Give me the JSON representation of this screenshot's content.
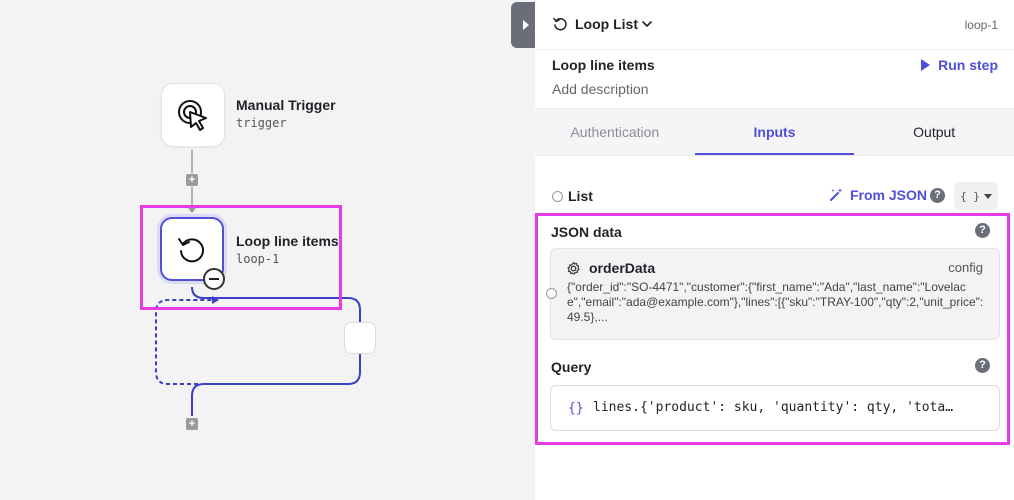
{
  "canvas": {
    "nodes": [
      {
        "title": "Manual Trigger",
        "subtitle": "trigger"
      },
      {
        "title": "Loop line items",
        "subtitle": "loop-1"
      }
    ]
  },
  "panel": {
    "header": {
      "title": "Loop List",
      "step_id": "loop-1"
    },
    "step_name": "Loop line items",
    "description_placeholder": "Add description",
    "run_step_label": "Run step",
    "tabs": [
      "Authentication",
      "Inputs",
      "Output"
    ],
    "active_tab": "Inputs",
    "list_label": "List",
    "from_json_label": "From JSON",
    "format_toggle": "{ }",
    "json_data": {
      "label": "JSON data",
      "variable_name": "orderData",
      "variable_source": "config",
      "value": "{\"order_id\":\"SO-4471\",\"customer\":{\"first_name\":\"Ada\",\"last_name\":\"Lovelace\",\"email\":\"ada@example.com\"},\"lines\":[{\"sku\":\"TRAY-100\",\"qty\":2,\"unit_price\":49.5},..."
    },
    "query": {
      "label": "Query",
      "prefix": "{}",
      "value": "lines.{'product': sku, 'quantity': qty, 'tota…"
    },
    "help_glyph": "?"
  },
  "colors": {
    "accent": "#4f4fd8",
    "highlight": "#e43ce6",
    "canvas_bg": "#f3f3f4"
  }
}
